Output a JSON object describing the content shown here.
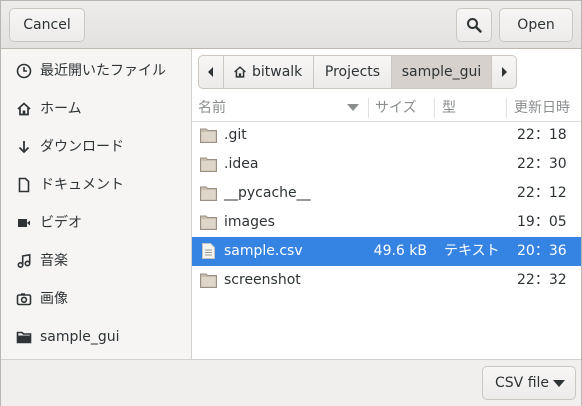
{
  "header": {
    "cancel_label": "Cancel",
    "open_label": "Open"
  },
  "sidebar": {
    "items": [
      {
        "label": "最近開いたファイル",
        "icon": "recent-icon"
      },
      {
        "label": "ホーム",
        "icon": "home-icon"
      },
      {
        "label": "ダウンロード",
        "icon": "download-icon"
      },
      {
        "label": "ドキュメント",
        "icon": "document-icon"
      },
      {
        "label": "ビデオ",
        "icon": "video-icon"
      },
      {
        "label": "音楽",
        "icon": "music-icon"
      },
      {
        "label": "画像",
        "icon": "image-icon"
      },
      {
        "label": "sample_gui",
        "icon": "folder-icon"
      }
    ]
  },
  "pathbar": {
    "segments": [
      "bitwalk",
      "Projects",
      "sample_gui"
    ],
    "active": "sample_gui"
  },
  "columns": {
    "name": "名前",
    "size": "サイズ",
    "type": "型",
    "modified": "更新日時"
  },
  "files": [
    {
      "name": ".git",
      "size": "",
      "type": "",
      "modified": "22：18",
      "icon": "folder-icon"
    },
    {
      "name": ".idea",
      "size": "",
      "type": "",
      "modified": "22：30",
      "icon": "folder-icon"
    },
    {
      "name": "__pycache__",
      "size": "",
      "type": "",
      "modified": "22：12",
      "icon": "folder-icon"
    },
    {
      "name": "images",
      "size": "",
      "type": "",
      "modified": "19：05",
      "icon": "folder-icon"
    },
    {
      "name": "sample.csv",
      "size": "49.6 kB",
      "type": "テキスト",
      "modified": "20：36",
      "icon": "text-file-icon",
      "selected": true
    },
    {
      "name": "screenshot",
      "size": "",
      "type": "",
      "modified": "22：32",
      "icon": "folder-icon"
    }
  ],
  "footer": {
    "filter_label": "CSV file"
  },
  "colors": {
    "selection": "#3584e4",
    "folder": "#c9bfae"
  }
}
